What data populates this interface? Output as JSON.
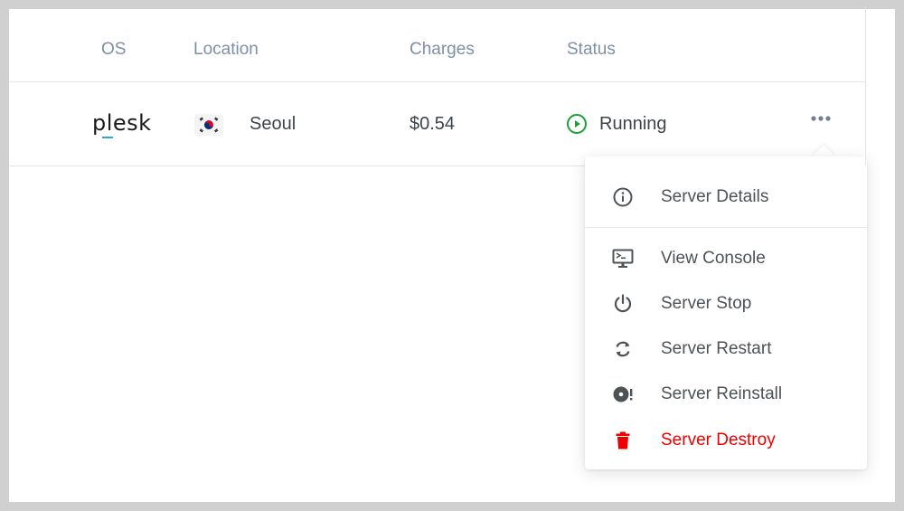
{
  "table": {
    "headers": {
      "os": "OS",
      "location": "Location",
      "charges": "Charges",
      "status": "Status"
    },
    "row": {
      "os_logo_text": "plesk",
      "flag_icon": "south-korea-flag-icon",
      "location": "Seoul",
      "charges": "$0.54",
      "status": "Running",
      "status_icon": "play-circle-icon",
      "actions_icon": "more-horizontal-icon"
    }
  },
  "menu": {
    "items": [
      {
        "label": "Server Details",
        "icon": "info-icon"
      },
      {
        "label": "View Console",
        "icon": "console-icon"
      },
      {
        "label": "Server Stop",
        "icon": "power-icon"
      },
      {
        "label": "Server Restart",
        "icon": "restart-icon"
      },
      {
        "label": "Server Reinstall",
        "icon": "reinstall-icon"
      },
      {
        "label": "Server Destroy",
        "icon": "trash-icon"
      }
    ]
  },
  "colors": {
    "header_text": "#7f8fa8",
    "running_green": "#1f9d3a",
    "danger_red": "#ee0000",
    "menu_icon": "#4d5256"
  }
}
